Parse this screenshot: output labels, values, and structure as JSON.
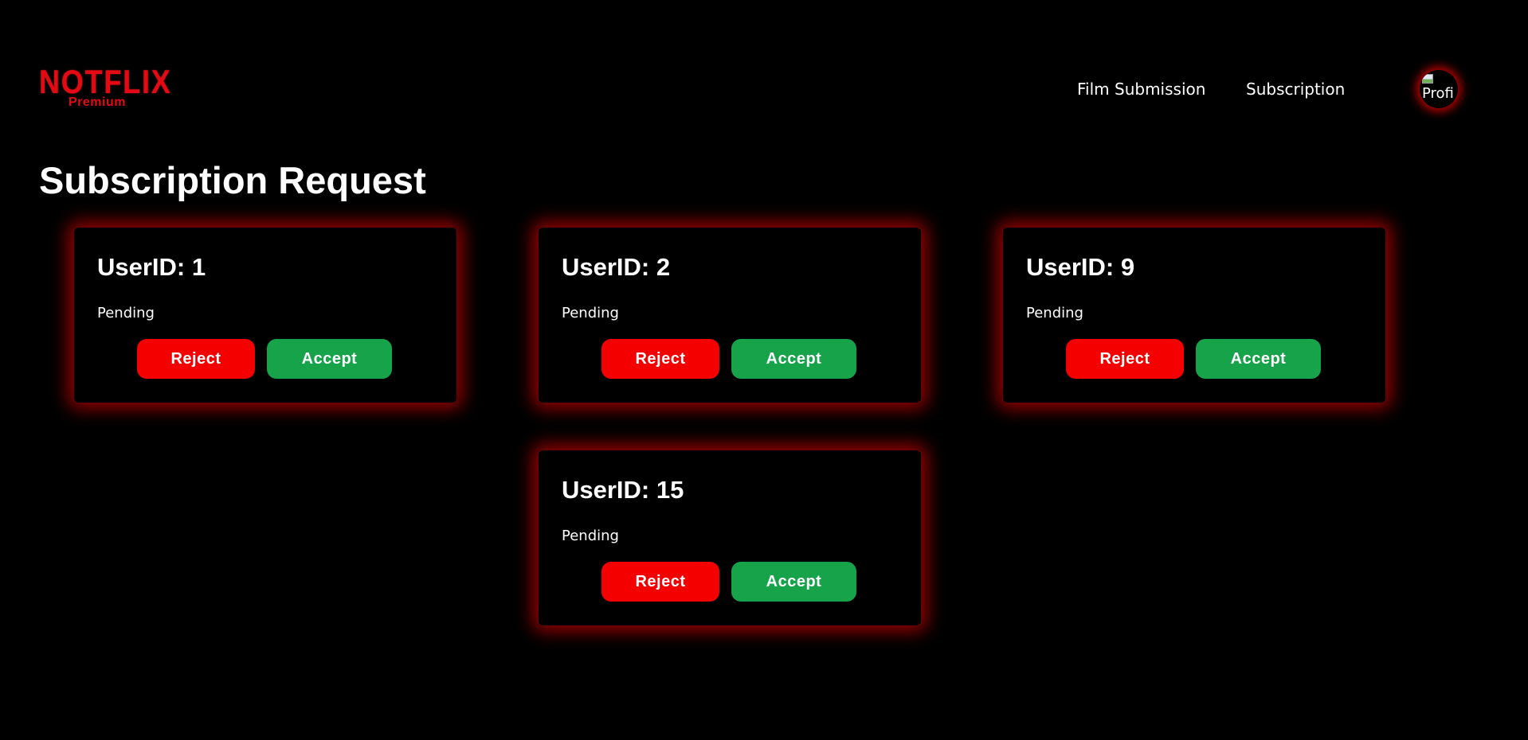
{
  "header": {
    "logo": {
      "main": "NOTFLIX",
      "sub": "Premium"
    },
    "nav": [
      {
        "label": "Film Submission"
      },
      {
        "label": "Subscription"
      }
    ],
    "avatar": {
      "alt_text_visible": "Profi",
      "icon": "broken-image-icon"
    }
  },
  "main": {
    "title": "Subscription Request",
    "requests": [
      {
        "user_label": "UserID: 1",
        "status": "Pending",
        "reject_label": "Reject",
        "accept_label": "Accept"
      },
      {
        "user_label": "UserID: 2",
        "status": "Pending",
        "reject_label": "Reject",
        "accept_label": "Accept"
      },
      {
        "user_label": "UserID: 9",
        "status": "Pending",
        "reject_label": "Reject",
        "accept_label": "Accept"
      },
      {
        "user_label": "UserID: 15",
        "status": "Pending",
        "reject_label": "Reject",
        "accept_label": "Accept"
      }
    ]
  },
  "colors": {
    "background": "#000000",
    "brand_red": "#e50914",
    "reject": "#f50000",
    "accept": "#17a34a",
    "glow": "#aa0000",
    "text": "#ffffff"
  }
}
